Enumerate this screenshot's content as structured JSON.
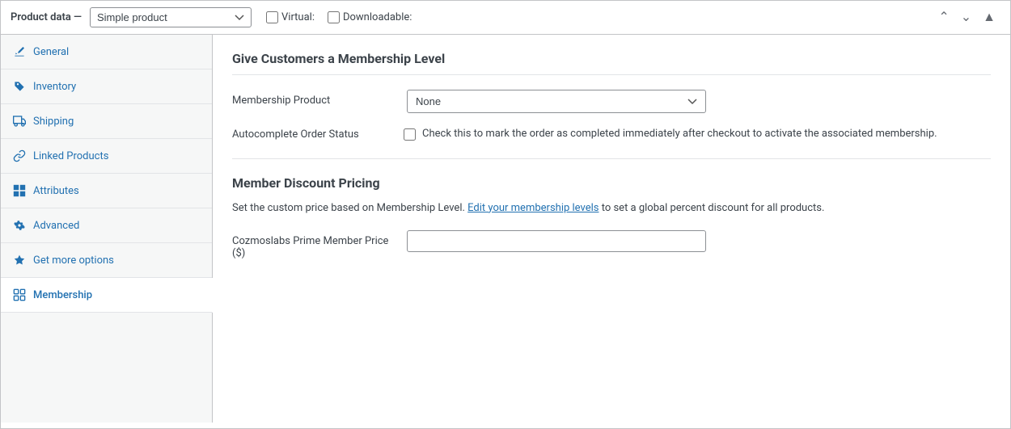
{
  "header": {
    "label": "Product data —",
    "product_type_default": "Simple product",
    "virtual_label": "Virtual:",
    "downloadable_label": "Downloadable:",
    "actions": {
      "up": "▲",
      "down": "▼",
      "collapse": "▲"
    }
  },
  "sidebar": {
    "items": [
      {
        "id": "general",
        "label": "General",
        "icon": "wrench"
      },
      {
        "id": "inventory",
        "label": "Inventory",
        "icon": "tag"
      },
      {
        "id": "shipping",
        "label": "Shipping",
        "icon": "truck"
      },
      {
        "id": "linked-products",
        "label": "Linked Products",
        "icon": "link"
      },
      {
        "id": "attributes",
        "label": "Attributes",
        "icon": "grid"
      },
      {
        "id": "advanced",
        "label": "Advanced",
        "icon": "gear"
      },
      {
        "id": "get-more-options",
        "label": "Get more options",
        "icon": "wrench2"
      },
      {
        "id": "membership",
        "label": "Membership",
        "icon": "users"
      }
    ]
  },
  "main": {
    "membership_section_title": "Give Customers a Membership Level",
    "membership_product_label": "Membership Product",
    "membership_product_default": "None",
    "autocomplete_label": "Autocomplete Order Status",
    "autocomplete_desc": "Check this to mark the order as completed immediately after checkout to activate the associated membership.",
    "discount_section_title": "Member Discount Pricing",
    "discount_desc_before_link": "Set the custom price based on Membership Level.",
    "discount_link_text": "Edit your membership levels",
    "discount_desc_after_link": "to set a global percent discount for all products.",
    "price_label": "Cozmoslabs Prime Member Price ($)",
    "price_placeholder": ""
  }
}
